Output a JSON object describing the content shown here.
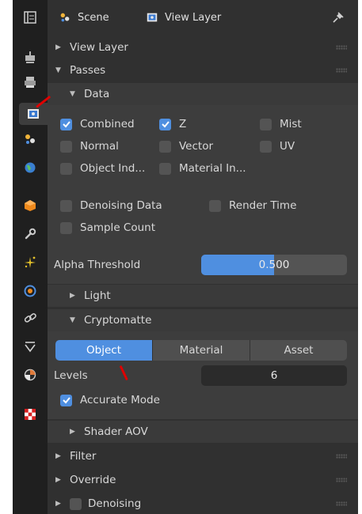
{
  "header": {
    "scene_label": "Scene",
    "view_layer_label": "View Layer"
  },
  "tabs": [
    {
      "icon": "tool-icon"
    },
    {
      "icon": "render-icon"
    },
    {
      "icon": "output-icon"
    },
    {
      "icon": "view-layer-icon",
      "active": true
    },
    {
      "icon": "scene-icon"
    },
    {
      "icon": "world-icon"
    },
    {
      "icon": "object-icon"
    },
    {
      "icon": "modifier-icon"
    },
    {
      "icon": "particles-icon"
    },
    {
      "icon": "physics-icon"
    },
    {
      "icon": "constraints-icon"
    },
    {
      "icon": "data-icon"
    },
    {
      "icon": "material-icon"
    },
    {
      "icon": "texture-icon"
    }
  ],
  "panels": {
    "view_layer": "View Layer",
    "passes": "Passes",
    "data": "Data",
    "light": "Light",
    "cryptomatte": "Cryptomatte",
    "shader_aov": "Shader AOV",
    "filter": "Filter",
    "override": "Override",
    "denoising": "Denoising"
  },
  "data_passes": {
    "combined": "Combined",
    "z": "Z",
    "mist": "Mist",
    "normal": "Normal",
    "vector": "Vector",
    "uv": "UV",
    "object_index": "Object Ind...",
    "material_index": "Material In...",
    "denoising_data": "Denoising Data",
    "render_time": "Render Time",
    "sample_count": "Sample Count",
    "alpha_label": "Alpha Threshold",
    "alpha_value": "0.500",
    "alpha_fraction": 0.5
  },
  "cryptomatte": {
    "segments": [
      "Object",
      "Material",
      "Asset"
    ],
    "levels_label": "Levels",
    "levels_value": "6",
    "accurate_mode": "Accurate Mode"
  },
  "colors": {
    "accent": "#4f8fe0",
    "annotation": "#e00000"
  }
}
